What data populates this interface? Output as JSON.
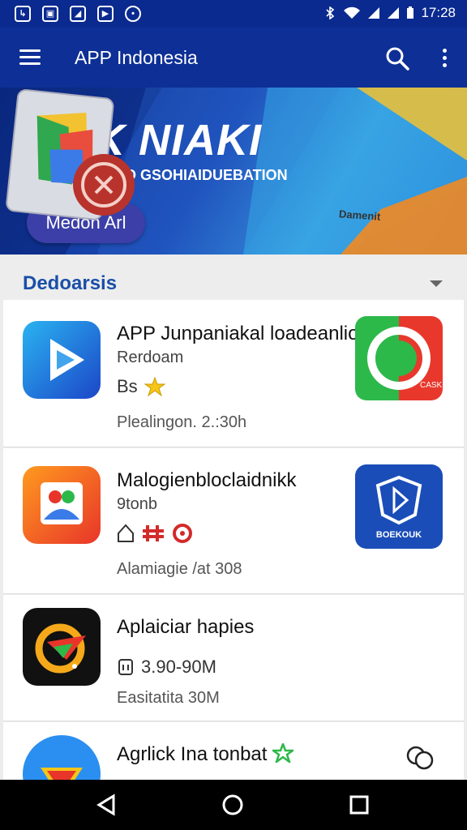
{
  "status_bar": {
    "time": "17:28",
    "left_icons": [
      "notification-icon",
      "message-icon",
      "photo-icon",
      "play-icon",
      "chat-icon"
    ],
    "right_icons": [
      "bluetooth-icon",
      "wifi-icon",
      "signal-icon",
      "signal-icon",
      "battery-icon"
    ]
  },
  "app_bar": {
    "title": "APP Indonesia",
    "color": "#0d2f96"
  },
  "banner": {
    "title": "APK NIAKI",
    "subtitle": "STEONACFIVO GSOHIAIDUEBATION",
    "button_label": "Medon Arl",
    "art_label": "Damenit"
  },
  "section": {
    "title": "Dedoarsis"
  },
  "apps": [
    {
      "name": "APP Junpaniakal loadeanliotord",
      "developer": "Rerdoam",
      "badges": "Bs",
      "meta": "Plealingon. 2.:30h",
      "side_label": "CASK"
    },
    {
      "name": "Malogienbloclaidnikk",
      "developer": "9tonb",
      "badges": "",
      "meta": "Alamiagie /at 308",
      "side_label": "BOEKOUK"
    },
    {
      "name": "Aplaiciar hapies",
      "developer": "",
      "badges": "3.90-90M",
      "meta": "Easitatita 30M",
      "side_label": ""
    },
    {
      "name": "Agrlick Ina tonbat",
      "developer": "",
      "badges": "",
      "meta": "",
      "side_label": ""
    }
  ],
  "nav_bar": {
    "buttons": [
      "back-icon",
      "home-icon",
      "recents-icon"
    ]
  },
  "colors": {
    "primary": "#0d2f96",
    "accent": "#1a4fa8",
    "status": "#0a2a8f"
  }
}
